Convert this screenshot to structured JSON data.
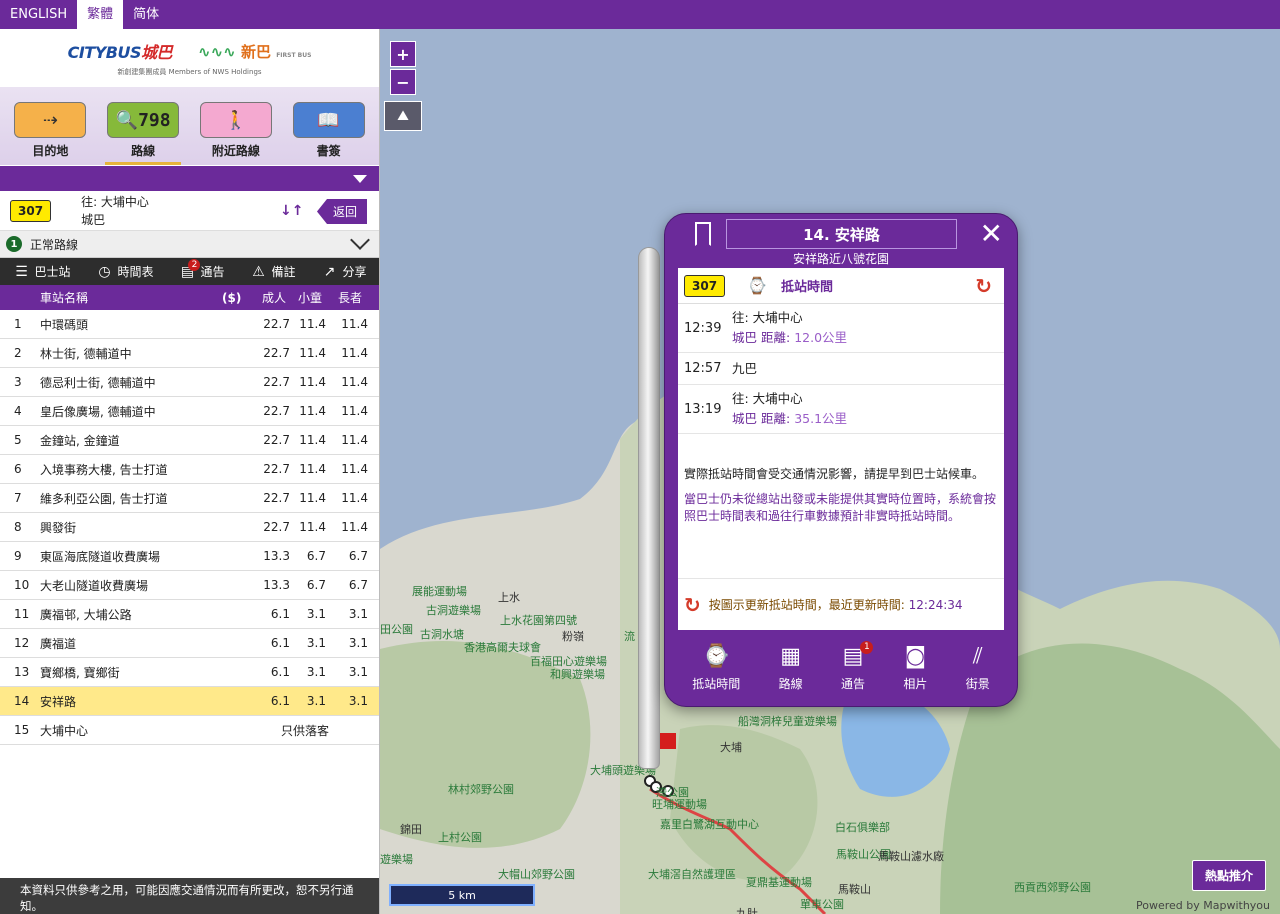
{
  "languages": [
    {
      "label": "ENGLISH",
      "active": false
    },
    {
      "label": "繁體",
      "active": true
    },
    {
      "label": "简体",
      "active": false
    }
  ],
  "logo": {
    "citybus_text": "CITYBUS",
    "citybus_cn": "城巴",
    "firstbus_cn": "新巴",
    "firstbus_en": "FIRST BUS",
    "subtitle": "新創建集團成員 Members of NWS Holdings"
  },
  "nav": {
    "items": [
      {
        "label": "目的地",
        "icon": "destination-icon"
      },
      {
        "label": "路線",
        "icon": "route-search-icon",
        "icon_text": "798"
      },
      {
        "label": "附近路線",
        "icon": "nearby-route-icon"
      },
      {
        "label": "書簽",
        "icon": "bookmark-book-icon"
      }
    ],
    "active_index": 1
  },
  "route": {
    "number": "307",
    "destination": "往: 大埔中心",
    "operator": "城巴",
    "back_label": "返回"
  },
  "route_type": {
    "number": "1",
    "label": "正常路線"
  },
  "toolbar": {
    "stops_label": "巴士站",
    "timetable_label": "時間表",
    "notice_label": "通告",
    "notice_count": "2",
    "remarks_label": "備註",
    "share_label": "分享"
  },
  "table": {
    "headers": {
      "name": "車站名稱",
      "currency": "($)",
      "adult": "成人",
      "child": "小童",
      "senior": "長者"
    },
    "rows": [
      {
        "no": "1",
        "name": "中環碼頭",
        "adult": "22.7",
        "child": "11.4",
        "senior": "11.4"
      },
      {
        "no": "2",
        "name": "林士街, 德輔道中",
        "adult": "22.7",
        "child": "11.4",
        "senior": "11.4"
      },
      {
        "no": "3",
        "name": "德忌利士街, 德輔道中",
        "adult": "22.7",
        "child": "11.4",
        "senior": "11.4"
      },
      {
        "no": "4",
        "name": "皇后像廣場, 德輔道中",
        "adult": "22.7",
        "child": "11.4",
        "senior": "11.4"
      },
      {
        "no": "5",
        "name": "金鐘站, 金鐘道",
        "adult": "22.7",
        "child": "11.4",
        "senior": "11.4"
      },
      {
        "no": "6",
        "name": "入境事務大樓, 告士打道",
        "adult": "22.7",
        "child": "11.4",
        "senior": "11.4"
      },
      {
        "no": "7",
        "name": "維多利亞公園, 告士打道",
        "adult": "22.7",
        "child": "11.4",
        "senior": "11.4"
      },
      {
        "no": "8",
        "name": "興發街",
        "adult": "22.7",
        "child": "11.4",
        "senior": "11.4"
      },
      {
        "no": "9",
        "name": "東區海底隧道收費廣場",
        "adult": "13.3",
        "child": "6.7",
        "senior": "6.7"
      },
      {
        "no": "10",
        "name": "大老山隧道收費廣場",
        "adult": "13.3",
        "child": "6.7",
        "senior": "6.7"
      },
      {
        "no": "11",
        "name": "廣福邨, 大埔公路",
        "adult": "6.1",
        "child": "3.1",
        "senior": "3.1"
      },
      {
        "no": "12",
        "name": "廣福道",
        "adult": "6.1",
        "child": "3.1",
        "senior": "3.1"
      },
      {
        "no": "13",
        "name": "寶鄉橋, 寶鄉街",
        "adult": "6.1",
        "child": "3.1",
        "senior": "3.1"
      },
      {
        "no": "14",
        "name": "安祥路",
        "adult": "6.1",
        "child": "3.1",
        "senior": "3.1",
        "selected": true
      }
    ],
    "last_row": {
      "no": "15",
      "name": "大埔中心",
      "note": "只供落客"
    }
  },
  "disclaimer": "本資料只供參考之用，可能因應交通情況而有所更改，恕不另行通知。",
  "map": {
    "scale_label": "5 km",
    "hot_button": "熱點推介",
    "powered": "Powered by Mapwithyou",
    "labels": [
      {
        "text": "上水",
        "cls": "dark"
      },
      {
        "text": "上水花園第四號",
        "cls": "green"
      },
      {
        "text": "展能運動場",
        "cls": "green"
      },
      {
        "text": "古洞遊樂場",
        "cls": "green"
      },
      {
        "text": "古洞水塘",
        "cls": "green"
      },
      {
        "text": "香港高爾夫球會",
        "cls": "green"
      },
      {
        "text": "粉嶺",
        "cls": "dark"
      },
      {
        "text": "流",
        "cls": "green"
      },
      {
        "text": "百福田心遊樂場",
        "cls": "green"
      },
      {
        "text": "和興遊樂場",
        "cls": "green"
      },
      {
        "text": "林村郊野公園",
        "cls": "green"
      },
      {
        "text": "大埔頭遊樂場",
        "cls": "green"
      },
      {
        "text": "船灣洞梓兒童遊樂場",
        "cls": "green"
      },
      {
        "text": "大埔",
        "cls": "dark"
      },
      {
        "text": "嘉里白鷺湖互動中心",
        "cls": "green"
      },
      {
        "text": "白石俱樂部",
        "cls": "green"
      },
      {
        "text": "錦田",
        "cls": "dark"
      },
      {
        "text": "上村公園",
        "cls": "green"
      },
      {
        "text": "大帽山郊野公園",
        "cls": "green"
      },
      {
        "text": "大埔滘自然護理區",
        "cls": "green"
      },
      {
        "text": "馬鞍山公園",
        "cls": "green"
      },
      {
        "text": "馬鞍山濾水廠",
        "cls": "dark"
      },
      {
        "text": "夏鼎基運動場",
        "cls": "green"
      },
      {
        "text": "馬鞍山",
        "cls": "dark"
      },
      {
        "text": "西貢西郊野公園",
        "cls": "green"
      },
      {
        "text": "九肚",
        "cls": "dark"
      },
      {
        "text": "單車公園",
        "cls": "green"
      },
      {
        "text": "旺埔運動場",
        "cls": "green"
      },
      {
        "text": "灣公園",
        "cls": "green"
      },
      {
        "text": "田公園",
        "cls": "green"
      },
      {
        "text": "遊樂場",
        "cls": "green"
      }
    ]
  },
  "popup": {
    "title": "14. 安祥路",
    "subtitle": "安祥路近八號花園",
    "route_number": "307",
    "eta_title": "抵站時間",
    "etas": [
      {
        "time": "12:39",
        "dest": "往: 大埔中心",
        "operator": "城巴",
        "distance_label": "距離:",
        "distance": "12.0公里"
      },
      {
        "time": "12:57",
        "dest": "九巴"
      },
      {
        "time": "13:19",
        "dest": "往: 大埔中心",
        "operator": "城巴",
        "distance_label": "距離:",
        "distance": "35.1公里"
      }
    ],
    "notice1": "實際抵站時間會受交通情況影響，請提早到巴士站候車。",
    "notice2": "當巴士仍未從總站出發或未能提供其實時位置時，系統會按照巴士時間表和過往行車數據預計非實時抵站時間。",
    "update_text": "按圖示更新抵站時間，最近更新時間:",
    "update_time": "12:24:34",
    "footer": [
      {
        "label": "抵站時間",
        "icon": "eta-watch-icon"
      },
      {
        "label": "路線",
        "icon": "route-list-icon"
      },
      {
        "label": "通告",
        "icon": "notice-icon",
        "badge": "1"
      },
      {
        "label": "相片",
        "icon": "camera-icon"
      },
      {
        "label": "街景",
        "icon": "street-view-icon"
      }
    ]
  }
}
